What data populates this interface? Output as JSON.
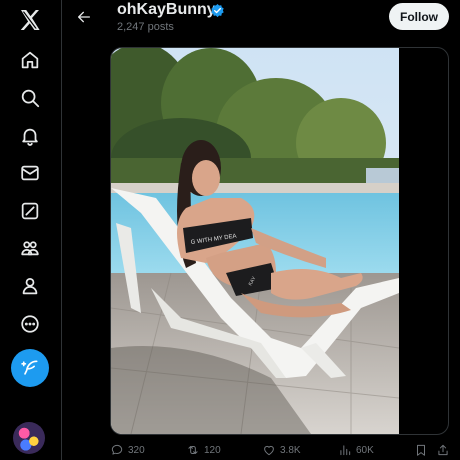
{
  "colors": {
    "accent": "#1d9bf0",
    "background": "#000000",
    "muted": "#71767b",
    "follow_bg": "#eff3f4"
  },
  "nav": {
    "items": [
      {
        "icon": "x-logo-icon"
      },
      {
        "icon": "home-icon"
      },
      {
        "icon": "search-icon"
      },
      {
        "icon": "bell-icon"
      },
      {
        "icon": "envelope-icon"
      },
      {
        "icon": "grok-icon"
      },
      {
        "icon": "communities-icon"
      },
      {
        "icon": "profile-icon"
      },
      {
        "icon": "more-circle-icon"
      }
    ],
    "post_button_icon": "feather-plus-icon"
  },
  "header": {
    "title": "ohKayBunny",
    "verified": true,
    "subtitle": "2,247 posts",
    "follow_label": "Follow"
  },
  "media": {
    "print_text": "G WITH MY DEA",
    "bottom_print": "KAY"
  },
  "actions": {
    "replies": "320",
    "reposts": "120",
    "likes": "3.8K",
    "views": "60K"
  }
}
